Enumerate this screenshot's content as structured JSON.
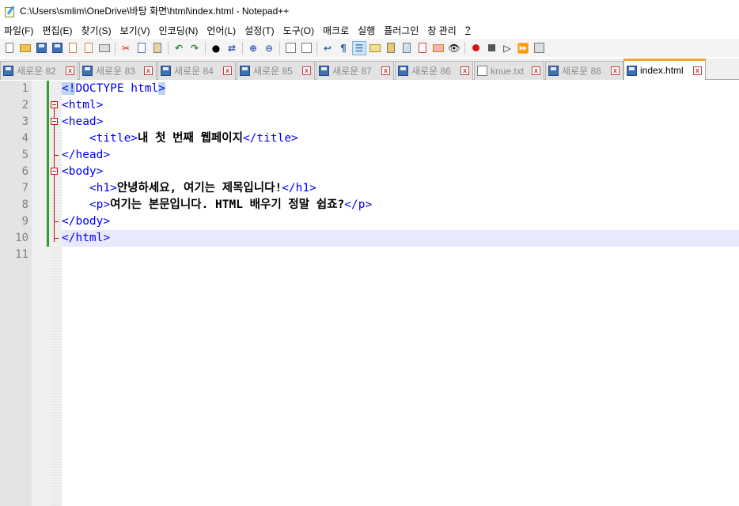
{
  "window": {
    "title": "C:\\Users\\smlim\\OneDrive\\바탕 화면\\html\\index.html - Notepad++"
  },
  "menu": [
    {
      "label": "파일(F)"
    },
    {
      "label": "편집(E)"
    },
    {
      "label": "찾기(S)"
    },
    {
      "label": "보기(V)"
    },
    {
      "label": "인코딩(N)"
    },
    {
      "label": "언어(L)"
    },
    {
      "label": "설정(T)"
    },
    {
      "label": "도구(O)"
    },
    {
      "label": "매크로"
    },
    {
      "label": "실행"
    },
    {
      "label": "플러그인"
    },
    {
      "label": "창 관리"
    },
    {
      "label": "?"
    }
  ],
  "tabs": [
    {
      "label": "새로운 82",
      "icon": "disk",
      "active": false
    },
    {
      "label": "새로운 83",
      "icon": "disk",
      "active": false
    },
    {
      "label": "새로운 84",
      "icon": "disk",
      "active": false
    },
    {
      "label": "새로운 85",
      "icon": "disk",
      "active": false
    },
    {
      "label": "새로운 87",
      "icon": "disk",
      "active": false
    },
    {
      "label": "새로운 86",
      "icon": "disk",
      "active": false
    },
    {
      "label": "knue.txt",
      "icon": "doc",
      "active": false
    },
    {
      "label": "새로운 88",
      "icon": "disk",
      "active": false
    },
    {
      "label": "index.html",
      "icon": "disk",
      "active": true
    }
  ],
  "editor": {
    "line_numbers": [
      "1",
      "2",
      "3",
      "4",
      "5",
      "6",
      "7",
      "8",
      "9",
      "10",
      "11"
    ],
    "current_line": 10,
    "lines": [
      {
        "indent": "",
        "parts": [
          {
            "t": "<!",
            "c": "doctype"
          },
          {
            "t": "DOCTYPE html",
            "c": "tag"
          },
          {
            "t": ">",
            "c": "doctype"
          }
        ]
      },
      {
        "indent": "",
        "parts": [
          {
            "t": "<html>",
            "c": "tag"
          }
        ]
      },
      {
        "indent": "",
        "parts": [
          {
            "t": "<head>",
            "c": "tag"
          }
        ]
      },
      {
        "indent": "    ",
        "parts": [
          {
            "t": "<title>",
            "c": "tag"
          },
          {
            "t": "내 첫 번째 웹페이지",
            "c": "bold"
          },
          {
            "t": "</title>",
            "c": "tag"
          }
        ]
      },
      {
        "indent": "",
        "parts": [
          {
            "t": "</head>",
            "c": "tag"
          }
        ]
      },
      {
        "indent": "",
        "parts": [
          {
            "t": "<body>",
            "c": "tag"
          }
        ]
      },
      {
        "indent": "    ",
        "parts": [
          {
            "t": "<h1>",
            "c": "tag"
          },
          {
            "t": "안녕하세요, 여기는 제목입니다!",
            "c": "bold"
          },
          {
            "t": "</h1>",
            "c": "tag"
          }
        ]
      },
      {
        "indent": "    ",
        "parts": [
          {
            "t": "<p>",
            "c": "tag"
          },
          {
            "t": "여기는 본문입니다. HTML 배우기 정말 쉽죠?",
            "c": "bold"
          },
          {
            "t": "</p>",
            "c": "tag"
          }
        ]
      },
      {
        "indent": "",
        "parts": [
          {
            "t": "</body>",
            "c": "tag"
          }
        ]
      },
      {
        "indent": "",
        "parts": [
          {
            "t": "</html>",
            "c": "tag"
          }
        ]
      },
      {
        "indent": "",
        "parts": []
      }
    ]
  },
  "colors": {
    "tag": "#0000ff",
    "active_tab_accent": "#f5a623",
    "current_line_bg": "#e8e8ff",
    "change_bar": "#2ea02e",
    "fold_marker": "#c01010"
  }
}
